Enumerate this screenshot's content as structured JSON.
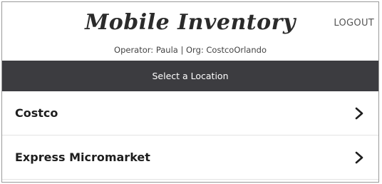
{
  "header": {
    "title": "Mobile Inventory",
    "operator_line": "Operator: Paula | Org: CostcoOrlando",
    "logout_label": "LOGOUT"
  },
  "subheader": {
    "label": "Select a Location"
  },
  "locations": [
    {
      "label": "Costco",
      "icon": "chevron-right-icon"
    },
    {
      "label": "Express Micromarket",
      "icon": "chevron-right-icon"
    }
  ],
  "colors": {
    "subheader_bg": "#3c3c40",
    "text": "#1e1e1e"
  }
}
